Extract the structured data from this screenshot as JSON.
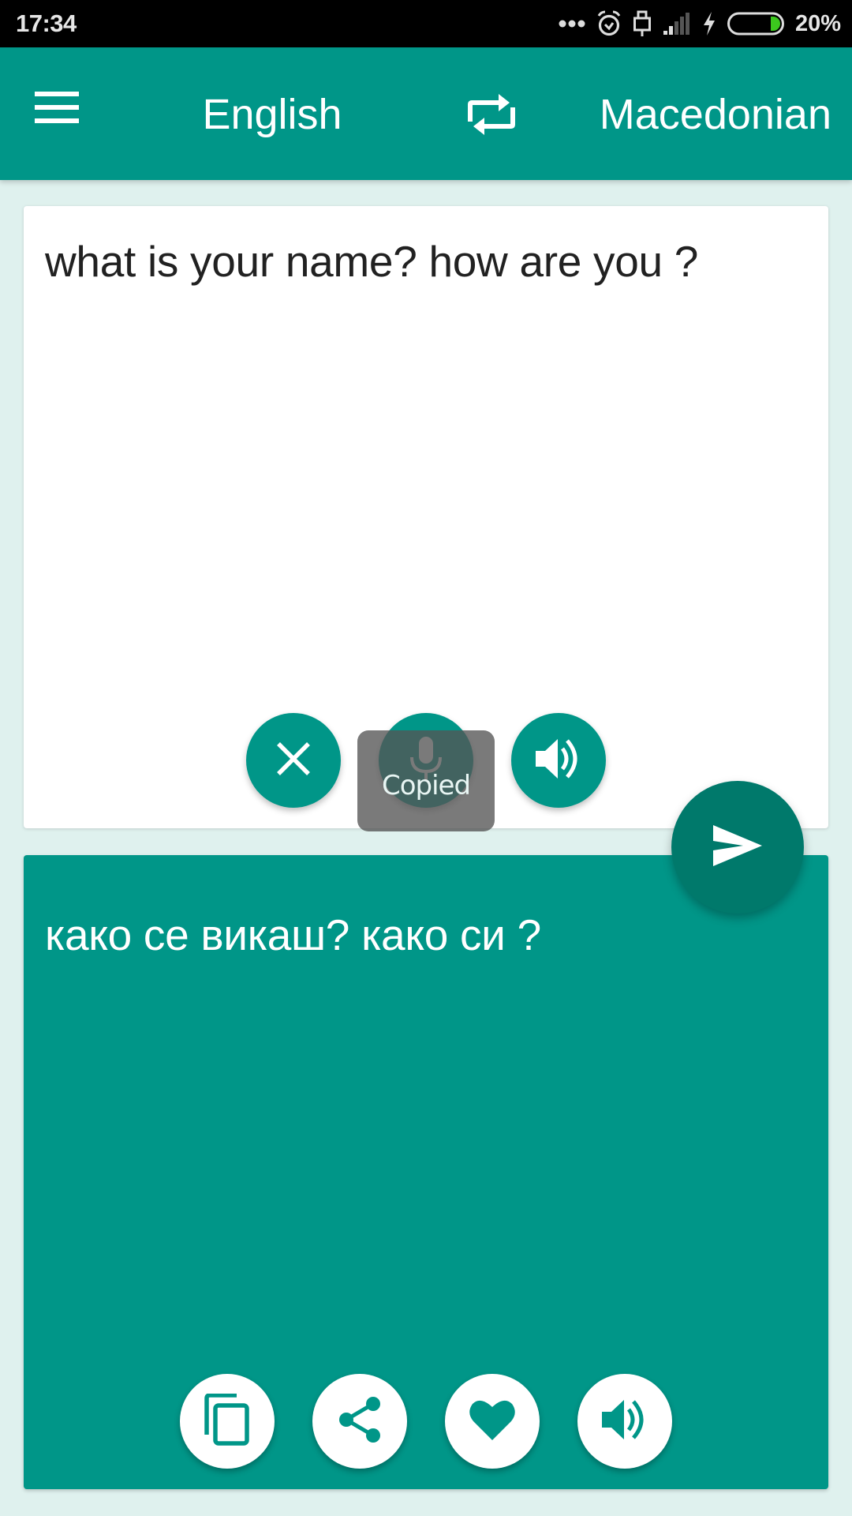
{
  "status_bar": {
    "time": "17:34",
    "icons": [
      "more-notifications-icon",
      "alarm-icon",
      "usb-icon",
      "signal-icon",
      "charging-icon",
      "battery-icon"
    ],
    "battery_percent": "20%",
    "battery_color": "#3cc81e"
  },
  "app_bar": {
    "menu_icon": "hamburger-menu-icon",
    "source_language": "English",
    "swap_icon": "swap-languages-icon",
    "target_language": "Macedonian",
    "color": "#009688"
  },
  "input_card": {
    "text": "what is your name? how are you ?",
    "buttons": [
      {
        "name": "clear",
        "icon": "close-icon"
      },
      {
        "name": "voice-input",
        "icon": "microphone-icon"
      },
      {
        "name": "speak-source",
        "icon": "speaker-icon"
      }
    ]
  },
  "toast": {
    "text": "Copied"
  },
  "send_button": {
    "icon": "send-icon",
    "color": "#00796b"
  },
  "output_card": {
    "text": "како се викаш? како си ?",
    "buttons": [
      {
        "name": "copy",
        "icon": "copy-icon"
      },
      {
        "name": "share",
        "icon": "share-icon"
      },
      {
        "name": "favorite",
        "icon": "heart-icon"
      },
      {
        "name": "speak-translation",
        "icon": "speaker-icon"
      }
    ]
  },
  "colors": {
    "primary": "#009688",
    "primary_dark": "#00796b",
    "background": "#dff1ee"
  }
}
